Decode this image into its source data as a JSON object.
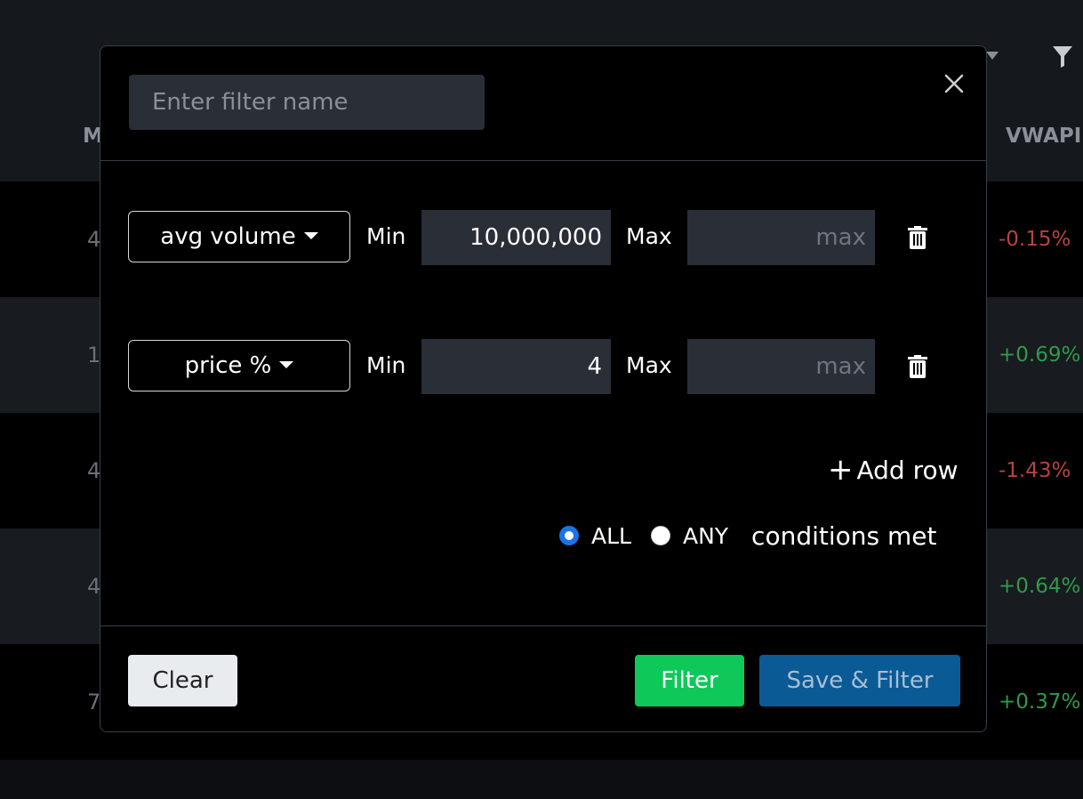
{
  "background": {
    "column_left": "M",
    "column_vwap": "VWAPI",
    "rows": [
      {
        "left": "4",
        "vwap": "-0.15%",
        "sign": "neg"
      },
      {
        "left": "1",
        "vwap": "+0.69%",
        "sign": "pos"
      },
      {
        "left": "4",
        "vwap": "-1.43%",
        "sign": "neg"
      },
      {
        "left": "4",
        "vwap": "+0.64%",
        "sign": "pos"
      },
      {
        "left": "7",
        "vwap": "+0.37%",
        "sign": "pos"
      }
    ]
  },
  "modal": {
    "name_placeholder": "Enter filter name",
    "name_value": "",
    "rows": [
      {
        "field": "avg volume",
        "min_label": "Min",
        "min_value": "10,000,000",
        "max_label": "Max",
        "max_placeholder": "max"
      },
      {
        "field": "price %",
        "min_label": "Min",
        "min_value": "4",
        "max_label": "Max",
        "max_placeholder": "max"
      }
    ],
    "add_row_label": "Add row",
    "match_options": [
      {
        "label": "ALL",
        "checked": true
      },
      {
        "label": "ANY",
        "checked": false
      }
    ],
    "match_suffix": "conditions met",
    "buttons": {
      "clear": "Clear",
      "filter": "Filter",
      "save_filter": "Save & Filter"
    }
  },
  "colors": {
    "filter_button": "#0ec95a",
    "save_button": "#0a5a96",
    "radio_accent": "#1a73e8",
    "negative": "#b8433f",
    "positive": "#2f9a4a"
  }
}
